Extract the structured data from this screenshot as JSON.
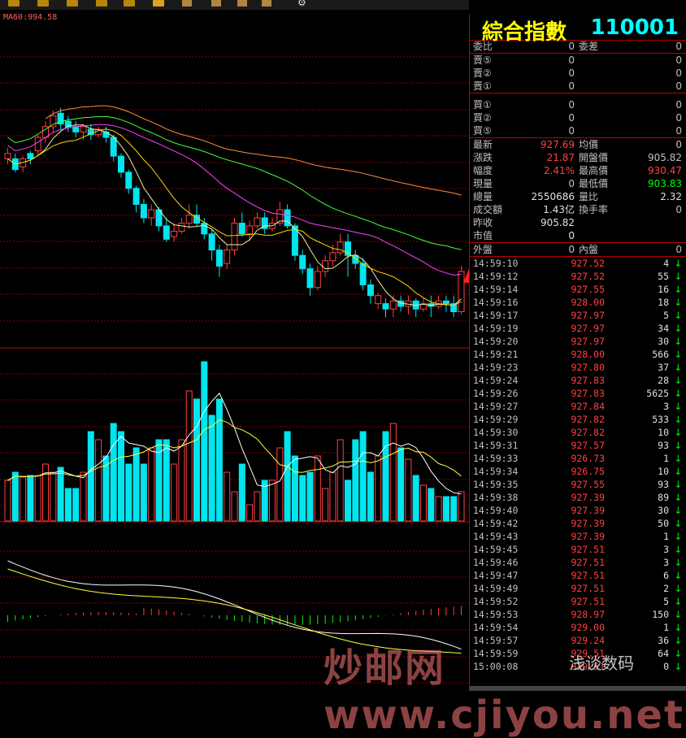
{
  "indicator_label": "MA60:994.58",
  "panel": {
    "name": "綜合指數",
    "code": "110001",
    "order_ratio": {
      "l1": "委比",
      "v1": "0",
      "l2": "委差",
      "v2": "0"
    },
    "sell_levels": [
      {
        "label": "賣⑤",
        "price": "0",
        "vol": "0"
      },
      {
        "label": "賣②",
        "price": "0",
        "vol": "0"
      },
      {
        "label": "賣①",
        "price": "0",
        "vol": "0"
      }
    ],
    "buy_levels": [
      {
        "label": "買①",
        "price": "0",
        "vol": "0"
      },
      {
        "label": "買②",
        "price": "0",
        "vol": "0"
      },
      {
        "label": "買⑤",
        "price": "0",
        "vol": "0"
      }
    ],
    "stats": [
      {
        "l1": "最新",
        "v1": "927.69",
        "v1c": "#ff4040",
        "l2": "均價",
        "v2": "0",
        "v2c": "#c0c0c0"
      },
      {
        "l1": "漲跌",
        "v1": "21.87",
        "v1c": "#ff4040",
        "l2": "開盤價",
        "v2": "905.82",
        "v2c": "#c0c0c0"
      },
      {
        "l1": "幅度",
        "v1": "2.41%",
        "v1c": "#ff4040",
        "l2": "最高價",
        "v2": "930.47",
        "v2c": "#ff4040"
      },
      {
        "l1": "現量",
        "v1": "0",
        "v1c": "#c0c0c0",
        "l2": "最低價",
        "v2": "903.83",
        "v2c": "#00ff00"
      },
      {
        "l1": "總量",
        "v1": "2550686",
        "v1c": "#e0e0e0",
        "l2": "量比",
        "v2": "2.32",
        "v2c": "#e0e0e0"
      },
      {
        "l1": "成交額",
        "v1": "1.43亿",
        "v1c": "#e0e0e0",
        "l2": "換手率",
        "v2": "0",
        "v2c": "#c0c0c0"
      },
      {
        "l1": "昨收",
        "v1": "905.82",
        "v1c": "#e0e0e0",
        "l2": "",
        "v2": "",
        "v2c": "#c0c0c0"
      },
      {
        "l1": "市值",
        "v1": "0",
        "v1c": "#e0e0e0",
        "l2": "",
        "v2": "",
        "v2c": "#c0c0c0"
      }
    ],
    "outer_inner": {
      "l1": "外盤",
      "v1": "0",
      "l2": "內盤",
      "v2": "0"
    },
    "ticks": [
      {
        "time": "14:59:10",
        "price": "927.52",
        "vol": "4"
      },
      {
        "time": "14:59:12",
        "price": "927.52",
        "vol": "55"
      },
      {
        "time": "14:59:14",
        "price": "927.55",
        "vol": "16"
      },
      {
        "time": "14:59:16",
        "price": "928.00",
        "vol": "18"
      },
      {
        "time": "14:59:17",
        "price": "927.97",
        "vol": "5"
      },
      {
        "time": "14:59:19",
        "price": "927.97",
        "vol": "34"
      },
      {
        "time": "14:59:20",
        "price": "927.97",
        "vol": "30"
      },
      {
        "time": "14:59:21",
        "price": "928.00",
        "vol": "566"
      },
      {
        "time": "14:59:23",
        "price": "927.80",
        "vol": "37"
      },
      {
        "time": "14:59:24",
        "price": "927.83",
        "vol": "28"
      },
      {
        "time": "14:59:26",
        "price": "927.83",
        "vol": "5625"
      },
      {
        "time": "14:59:27",
        "price": "927.84",
        "vol": "3"
      },
      {
        "time": "14:59:29",
        "price": "927.82",
        "vol": "533"
      },
      {
        "time": "14:59:30",
        "price": "927.82",
        "vol": "10"
      },
      {
        "time": "14:59:31",
        "price": "927.57",
        "vol": "93"
      },
      {
        "time": "14:59:33",
        "price": "926.73",
        "vol": "1"
      },
      {
        "time": "14:59:34",
        "price": "926.75",
        "vol": "10"
      },
      {
        "time": "14:59:35",
        "price": "927.55",
        "vol": "93"
      },
      {
        "time": "14:59:38",
        "price": "927.39",
        "vol": "89"
      },
      {
        "time": "14:59:40",
        "price": "927.39",
        "vol": "30"
      },
      {
        "time": "14:59:42",
        "price": "927.39",
        "vol": "50"
      },
      {
        "time": "14:59:43",
        "price": "927.39",
        "vol": "1"
      },
      {
        "time": "14:59:45",
        "price": "927.51",
        "vol": "3"
      },
      {
        "time": "14:59:46",
        "price": "927.51",
        "vol": "3"
      },
      {
        "time": "14:59:47",
        "price": "927.51",
        "vol": "6"
      },
      {
        "time": "14:59:49",
        "price": "927.51",
        "vol": "2"
      },
      {
        "time": "14:59:52",
        "price": "927.51",
        "vol": "5"
      },
      {
        "time": "14:59:53",
        "price": "928.97",
        "vol": "150"
      },
      {
        "time": "14:59:54",
        "price": "929.00",
        "vol": "1"
      },
      {
        "time": "14:59:57",
        "price": "929.24",
        "vol": "36"
      },
      {
        "time": "14:59:59",
        "price": "929.51",
        "vol": "64"
      },
      {
        "time": "15:00:08",
        "price": "929.51",
        "vol": "0"
      }
    ]
  },
  "candles": [
    [
      0.36,
      0.38,
      0.34,
      0.4,
      1
    ],
    [
      0.38,
      0.42,
      0.36,
      0.43,
      0
    ],
    [
      0.41,
      0.38,
      0.37,
      0.43,
      1
    ],
    [
      0.38,
      0.36,
      0.35,
      0.4,
      0
    ],
    [
      0.35,
      0.3,
      0.29,
      0.37,
      1
    ],
    [
      0.3,
      0.26,
      0.24,
      0.32,
      1
    ],
    [
      0.26,
      0.22,
      0.2,
      0.28,
      1
    ],
    [
      0.21,
      0.25,
      0.19,
      0.27,
      0
    ],
    [
      0.24,
      0.26,
      0.22,
      0.28,
      0
    ],
    [
      0.26,
      0.28,
      0.24,
      0.3,
      0
    ],
    [
      0.28,
      0.26,
      0.25,
      0.31,
      1
    ],
    [
      0.27,
      0.29,
      0.25,
      0.31,
      0
    ],
    [
      0.29,
      0.27,
      0.26,
      0.3,
      1
    ],
    [
      0.28,
      0.3,
      0.26,
      0.32,
      0
    ],
    [
      0.3,
      0.37,
      0.29,
      0.39,
      0
    ],
    [
      0.37,
      0.43,
      0.36,
      0.45,
      0
    ],
    [
      0.43,
      0.49,
      0.42,
      0.51,
      0
    ],
    [
      0.49,
      0.55,
      0.48,
      0.58,
      0
    ],
    [
      0.55,
      0.6,
      0.53,
      0.62,
      0
    ],
    [
      0.6,
      0.57,
      0.55,
      0.63,
      1
    ],
    [
      0.57,
      0.63,
      0.56,
      0.65,
      0
    ],
    [
      0.63,
      0.68,
      0.6,
      0.69,
      0
    ],
    [
      0.67,
      0.65,
      0.62,
      0.69,
      1
    ],
    [
      0.65,
      0.62,
      0.6,
      0.66,
      1
    ],
    [
      0.62,
      0.59,
      0.55,
      0.64,
      1
    ],
    [
      0.59,
      0.62,
      0.55,
      0.63,
      0
    ],
    [
      0.62,
      0.66,
      0.6,
      0.68,
      0
    ],
    [
      0.66,
      0.72,
      0.64,
      0.76,
      0
    ],
    [
      0.72,
      0.78,
      0.7,
      0.82,
      0
    ],
    [
      0.77,
      0.72,
      0.7,
      0.79,
      1
    ],
    [
      0.72,
      0.62,
      0.6,
      0.74,
      1
    ],
    [
      0.62,
      0.66,
      0.58,
      0.67,
      0
    ],
    [
      0.66,
      0.63,
      0.61,
      0.68,
      1
    ],
    [
      0.63,
      0.6,
      0.58,
      0.64,
      1
    ],
    [
      0.6,
      0.64,
      0.58,
      0.66,
      0
    ],
    [
      0.64,
      0.62,
      0.6,
      0.65,
      1
    ],
    [
      0.62,
      0.57,
      0.54,
      0.63,
      1
    ],
    [
      0.57,
      0.63,
      0.55,
      0.64,
      0
    ],
    [
      0.63,
      0.74,
      0.62,
      0.76,
      0
    ],
    [
      0.74,
      0.79,
      0.72,
      0.81,
      0
    ],
    [
      0.79,
      0.86,
      0.77,
      0.89,
      0
    ],
    [
      0.86,
      0.8,
      0.78,
      0.87,
      1
    ],
    [
      0.8,
      0.76,
      0.74,
      0.82,
      1
    ],
    [
      0.76,
      0.73,
      0.7,
      0.78,
      1
    ],
    [
      0.73,
      0.69,
      0.66,
      0.74,
      1
    ],
    [
      0.69,
      0.74,
      0.66,
      0.82,
      0
    ],
    [
      0.74,
      0.77,
      0.72,
      0.79,
      0
    ],
    [
      0.77,
      0.85,
      0.75,
      0.87,
      0
    ],
    [
      0.85,
      0.89,
      0.83,
      0.92,
      0
    ],
    [
      0.89,
      0.92,
      0.88,
      0.94,
      1
    ],
    [
      0.92,
      0.94,
      0.9,
      0.97,
      0
    ],
    [
      0.94,
      0.91,
      0.89,
      0.97,
      1
    ],
    [
      0.91,
      0.93,
      0.89,
      0.95,
      0
    ],
    [
      0.93,
      0.91,
      0.89,
      0.96,
      1
    ],
    [
      0.91,
      0.94,
      0.9,
      0.97,
      0
    ],
    [
      0.94,
      0.92,
      0.9,
      0.95,
      1
    ],
    [
      0.92,
      0.93,
      0.89,
      0.97,
      0
    ],
    [
      0.93,
      0.91,
      0.89,
      0.94,
      1
    ],
    [
      0.91,
      0.92,
      0.89,
      0.95,
      0
    ],
    [
      0.92,
      0.95,
      0.89,
      0.97,
      0
    ],
    [
      0.95,
      0.8,
      0.78,
      0.96,
      1
    ]
  ],
  "volumes": [
    0.25,
    0.3,
    0.27,
    0.28,
    0.28,
    0.35,
    0.3,
    0.33,
    0.2,
    0.2,
    0.3,
    0.55,
    0.5,
    0.4,
    0.6,
    0.55,
    0.35,
    0.45,
    0.35,
    0.45,
    0.5,
    0.5,
    0.35,
    0.5,
    0.8,
    0.75,
    0.98,
    0.65,
    0.75,
    0.3,
    0.18,
    0.35,
    0.1,
    0.18,
    0.25,
    0.25,
    0.45,
    0.55,
    0.4,
    0.28,
    0.3,
    0.4,
    0.2,
    0.3,
    0.5,
    0.25,
    0.5,
    0.55,
    0.3,
    0.4,
    0.55,
    0.6,
    0.45,
    0.38,
    0.28,
    0.22,
    0.2,
    0.15,
    0.15,
    0.15,
    0.18
  ]
}
